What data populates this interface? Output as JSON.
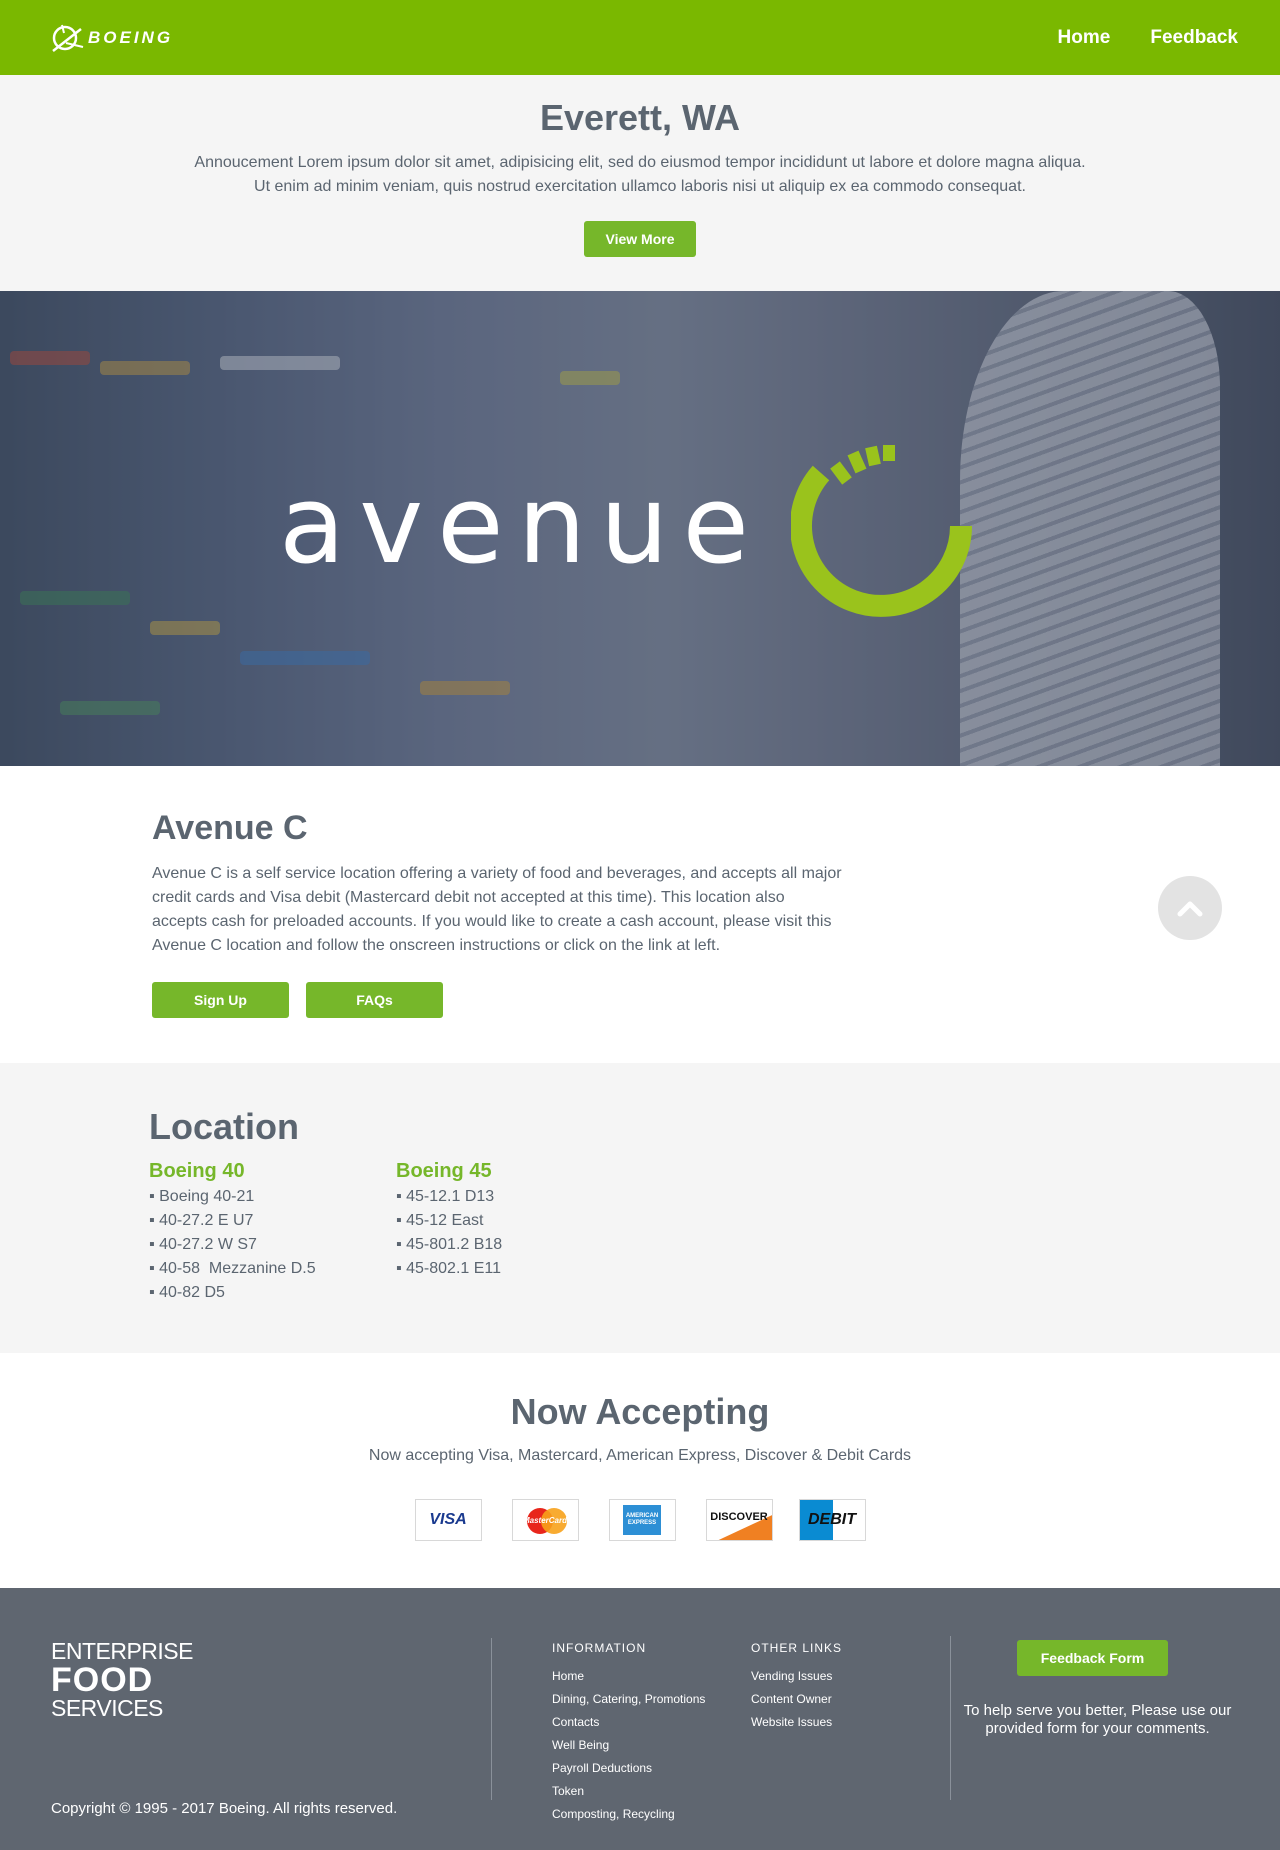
{
  "header": {
    "brand": "BOEING",
    "nav": [
      "Home",
      "Feedback"
    ]
  },
  "announcement": {
    "title": "Everett, WA",
    "line1": "Annoucement Lorem ipsum dolor sit amet, adipisicing elit, sed do eiusmod tempor incididunt ut labore et dolore magna aliqua.",
    "line2": "Ut enim ad minim veniam, quis nostrud exercitation ullamco laboris nisi ut aliquip ex ea commodo consequat.",
    "button": "View More"
  },
  "hero": {
    "logo_text": "avenue",
    "accent_color": "#9ac31c"
  },
  "about": {
    "title": "Avenue C",
    "description": "Avenue C is a self service location offering a variety of food and beverages, and accepts all major credit cards and Visa debit (Mastercard debit not accepted at this time). This location also accepts cash for preloaded accounts. If you would like to create a cash account, please visit this Avenue C location and follow the onscreen instructions or click on the link at left.",
    "buttons": [
      "Sign Up",
      "FAQs"
    ]
  },
  "location": {
    "title": "Location",
    "groups": [
      {
        "name": "Boeing 40",
        "items": [
          "▪ Boeing 40-21",
          "▪ 40-27.2 E U7",
          "▪ 40-27.2 W S7",
          "▪ 40-58  Mezzanine D.5",
          "▪ 40-82 D5"
        ]
      },
      {
        "name": "Boeing 45",
        "items": [
          "▪ 45-12.1 D13",
          "▪ 45-12 East",
          "▪ 45-801.2 B18",
          "▪ 45-802.1 E11"
        ]
      }
    ]
  },
  "accepting": {
    "title": "Now Accepting",
    "subtitle": "Now accepting Visa, Mastercard, American Express, Discover & Debit Cards",
    "cards": [
      "VISA",
      "MasterCard",
      "AMERICAN EXPRESS",
      "DISCOVER",
      "DEBIT"
    ]
  },
  "footer": {
    "logo": [
      "ENTERPRISE",
      "FOOD",
      "SERVICES"
    ],
    "copyright": "Copyright © 1995 - 2017 Boeing. All rights reserved.",
    "info_heading": "INFORMATION",
    "info_links": [
      "Home",
      "Dining, Catering, Promotions",
      "Contacts",
      "Well Being",
      "Payroll Deductions",
      "Token",
      "Composting, Recycling"
    ],
    "other_heading": "OTHER LINKS",
    "other_links": [
      "Vending Issues",
      "Content Owner",
      "Website Issues"
    ],
    "feedback_button": "Feedback Form",
    "feedback_text": "To help serve you better, Please use our provided form for your comments."
  },
  "colors": {
    "header_green": "#7ab800",
    "button_green": "#76b72a",
    "text_gray": "#5b6570",
    "footer_bg": "#5f6670"
  }
}
